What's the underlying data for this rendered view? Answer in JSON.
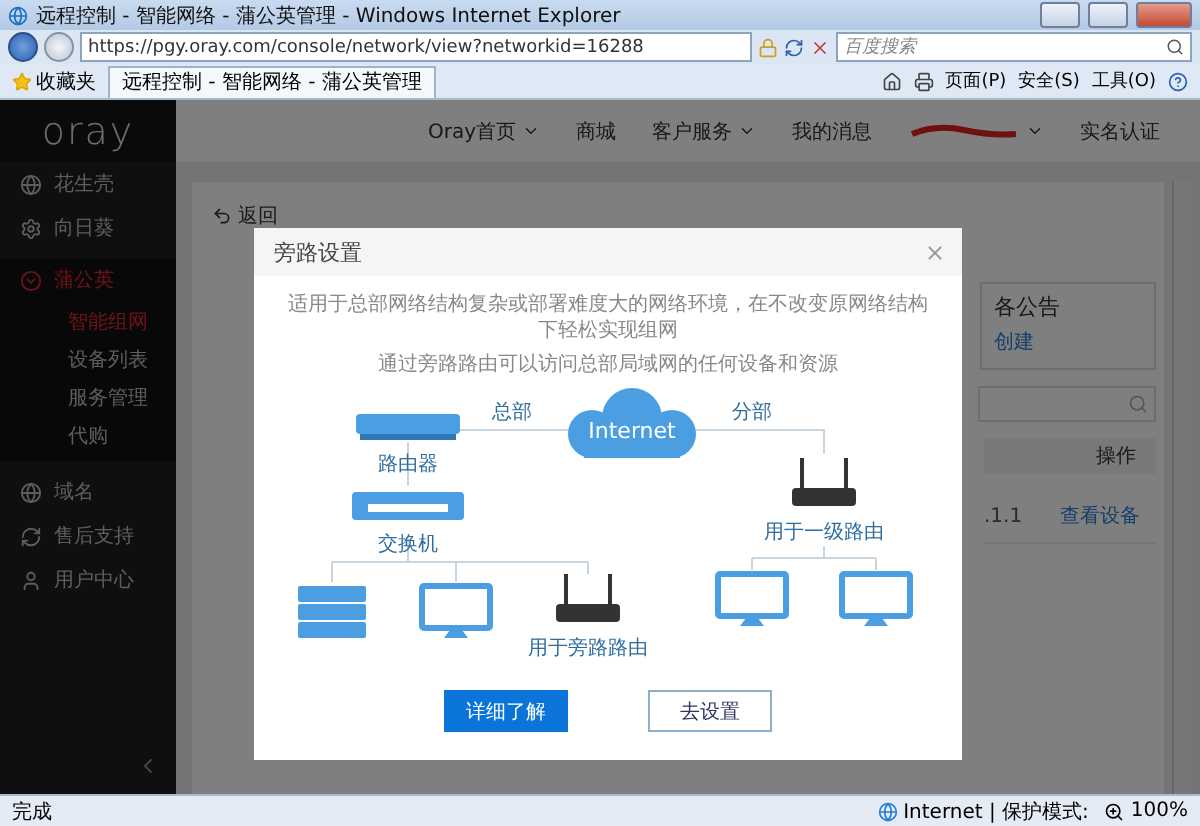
{
  "browser": {
    "title": "远程控制 - 智能网络 - 蒲公英管理 - Windows Internet Explorer",
    "url": "https://pgy.oray.com/console/network/view?networkid=16288",
    "search_placeholder": "百度搜索",
    "favorites": "收藏夹",
    "tab": "远程控制 - 智能网络 - 蒲公英管理",
    "tools": [
      "页面(P)",
      "安全(S)",
      "工具(O)"
    ]
  },
  "sidebar": {
    "logo": "oray",
    "items": [
      {
        "label": "花生壳",
        "selected": false
      },
      {
        "label": "向日葵",
        "selected": false
      },
      {
        "label": "蒲公英",
        "selected": true,
        "expanded": true,
        "children": [
          {
            "label": "智能组网",
            "selected": true
          },
          {
            "label": "设备列表",
            "selected": false
          },
          {
            "label": "服务管理",
            "selected": false
          },
          {
            "label": "代购",
            "selected": false
          }
        ]
      },
      {
        "label": "域名",
        "selected": false
      },
      {
        "label": "售后支持",
        "selected": false
      },
      {
        "label": "用户中心",
        "selected": false
      }
    ]
  },
  "topnav": [
    {
      "kind": "link",
      "label": "Oray首页",
      "dropdown": true
    },
    {
      "kind": "link",
      "label": "商城",
      "dropdown": false
    },
    {
      "kind": "link",
      "label": "客户服务",
      "dropdown": true
    },
    {
      "kind": "link",
      "label": "我的消息",
      "dropdown": false
    },
    {
      "kind": "redacted",
      "dropdown": true
    },
    {
      "kind": "link",
      "label": "实名认证",
      "dropdown": false
    }
  ],
  "content": {
    "back": "返回",
    "notice_title": "各公告",
    "notice_link": "创建",
    "table": {
      "columns": [
        "操作"
      ],
      "rows": [
        {
          "column_1": ".1.1",
          "action": "查看设备"
        }
      ]
    }
  },
  "dialog": {
    "title": "旁路设置",
    "description": [
      "适用于总部网络结构复杂或部署难度大的网络环境，在不改变原网络结构下轻松实现组网",
      "通过旁路路由可以访问总部局域网的任何设备和资源"
    ],
    "diagram": {
      "nodes": [
        {
          "kind": "router",
          "label": "路由器"
        },
        {
          "kind": "cloud",
          "label": "Internet"
        },
        {
          "kind": "wifi_router",
          "label": "用于一级路由"
        },
        {
          "kind": "switch",
          "label": "交换机"
        },
        {
          "kind": "server"
        },
        {
          "kind": "monitor"
        },
        {
          "kind": "wifi_router",
          "label": "用于旁路路由"
        },
        {
          "kind": "monitor"
        },
        {
          "kind": "monitor"
        }
      ],
      "links": [
        {
          "label": "总部"
        },
        {
          "label": "分部"
        }
      ]
    },
    "buttons": [
      {
        "kind": "primary",
        "label": "详细了解"
      },
      {
        "kind": "secondary",
        "label": "去设置"
      }
    ]
  },
  "status_bar": {
    "text": "完成",
    "zone": "Internet | 保护模式:",
    "zoom": "100%"
  }
}
